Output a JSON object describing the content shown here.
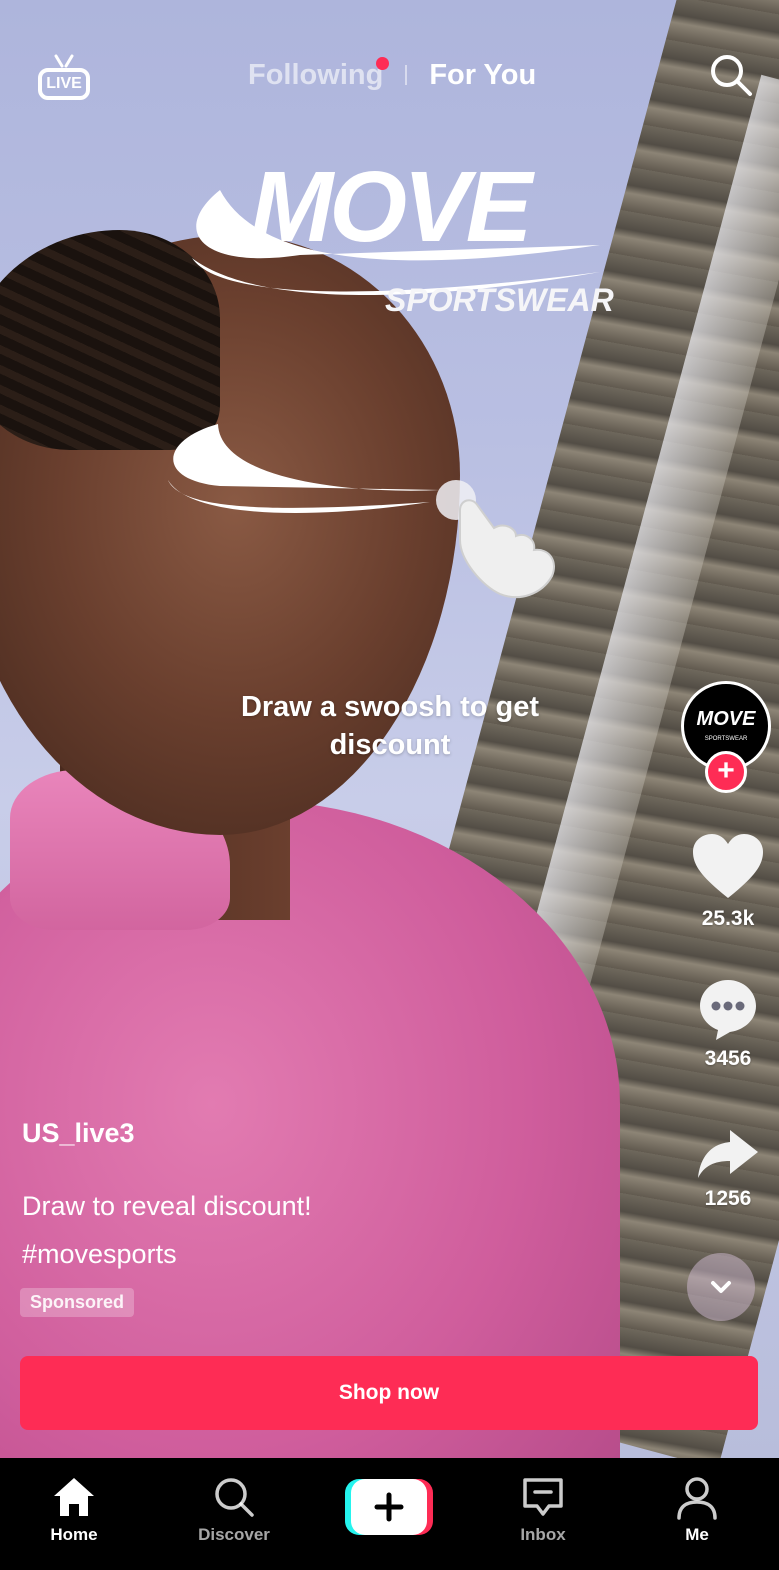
{
  "top_nav": {
    "live_label": "LIVE",
    "tabs": [
      "Following",
      "For You"
    ]
  },
  "ad": {
    "brand_name": "MOVE",
    "brand_sub": "SPORTSWEAR",
    "prompt": "Draw a swoosh to get discount"
  },
  "rail": {
    "avatar_text": "MOVE",
    "avatar_sub": "SPORTSWEAR",
    "follow_label": "+",
    "likes": "25.3k",
    "comments": "3456",
    "shares": "1256"
  },
  "post": {
    "username": "US_live3",
    "caption_line1": "Draw to reveal discount!",
    "hashtag": "#movesports",
    "sponsored_label": "Sponsored",
    "cta_label": "Shop now"
  },
  "bottom_nav": {
    "items": [
      "Home",
      "Discover",
      "Inbox",
      "Me"
    ]
  },
  "colors": {
    "accent": "#fe2c55",
    "cyan": "#25f4ee"
  },
  "icons": [
    "live-icon",
    "search-icon",
    "heart-icon",
    "comment-icon",
    "share-icon",
    "chevron-down-icon",
    "home-icon",
    "discover-icon",
    "plus-icon",
    "inbox-icon",
    "profile-icon",
    "hand-pointer-icon",
    "swoosh-icon"
  ]
}
